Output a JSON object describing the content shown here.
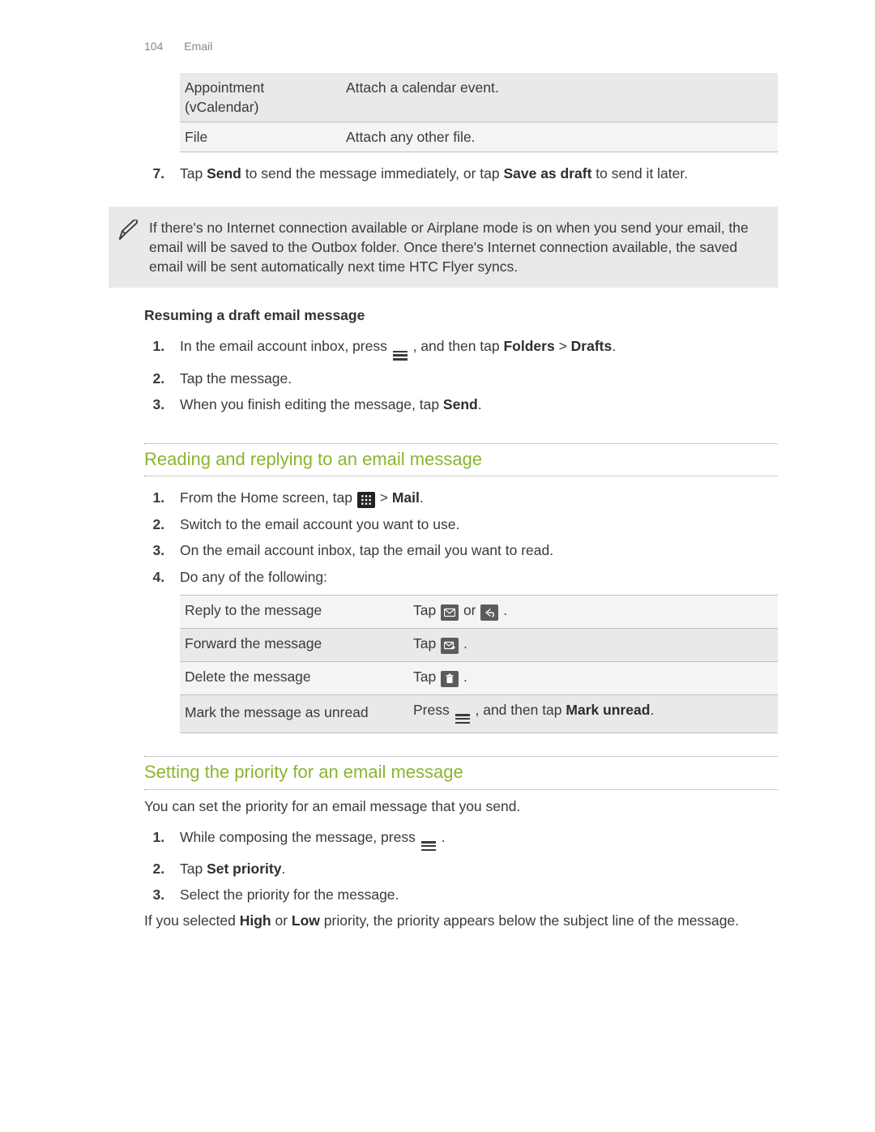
{
  "page": {
    "number": "104",
    "section": "Email"
  },
  "attach_table": {
    "rows": [
      {
        "label": "Appointment (vCalendar)",
        "desc": "Attach a calendar event."
      },
      {
        "label": "File",
        "desc": "Attach any other file."
      }
    ]
  },
  "step7": {
    "num": "7.",
    "pre": "Tap ",
    "b1": "Send",
    "mid": " to send the message immediately, or tap ",
    "b2": "Save as draft",
    "post": " to send it later."
  },
  "airplane_note": "If there's no Internet connection available or Airplane mode is on when you send your email, the email will be saved to the Outbox folder. Once there's Internet connection available, the saved email will be sent automatically next time HTC Flyer syncs.",
  "resume_draft": {
    "heading": "Resuming a draft email message",
    "items": {
      "i1": {
        "pre": "In the email account inbox, press ",
        "mid": " , and then tap ",
        "b1": "Folders",
        "gt": " > ",
        "b2": "Drafts",
        "post": "."
      },
      "i2": "Tap the message.",
      "i3": {
        "pre": "When you finish editing the message, tap ",
        "b": "Send",
        "post": "."
      }
    }
  },
  "reading": {
    "heading": "Reading and replying to an email message",
    "items": {
      "i1": {
        "pre": "From the Home screen, tap ",
        "gt": " > ",
        "b": "Mail",
        "post": "."
      },
      "i2": "Switch to the email account you want to use.",
      "i3": "On the email account inbox, tap the email you want to read.",
      "i4": "Do any of the following:"
    }
  },
  "actions_table": {
    "r1": {
      "label": "Reply to the message",
      "pre": "Tap ",
      "mid": " or ",
      "post": " ."
    },
    "r2": {
      "label": "Forward the message",
      "pre": "Tap ",
      "post": " ."
    },
    "r3": {
      "label": "Delete the message",
      "pre": "Tap ",
      "post": " ."
    },
    "r4": {
      "label": "Mark the message as unread",
      "pre": "Press ",
      "mid": " , and then tap ",
      "b": "Mark unread",
      "post": "."
    }
  },
  "priority": {
    "heading": "Setting the priority for an email message",
    "intro": "You can set the priority for an email message that you send.",
    "items": {
      "i1": {
        "pre": "While composing the message, press ",
        "post": " ."
      },
      "i2": {
        "pre": "Tap ",
        "b": "Set priority",
        "post": "."
      },
      "i3": "Select the priority for the message."
    },
    "closing": {
      "pre": "If you selected ",
      "b1": "High",
      "or": " or ",
      "b2": "Low",
      "post": " priority, the priority appears below the subject line of the message."
    }
  }
}
